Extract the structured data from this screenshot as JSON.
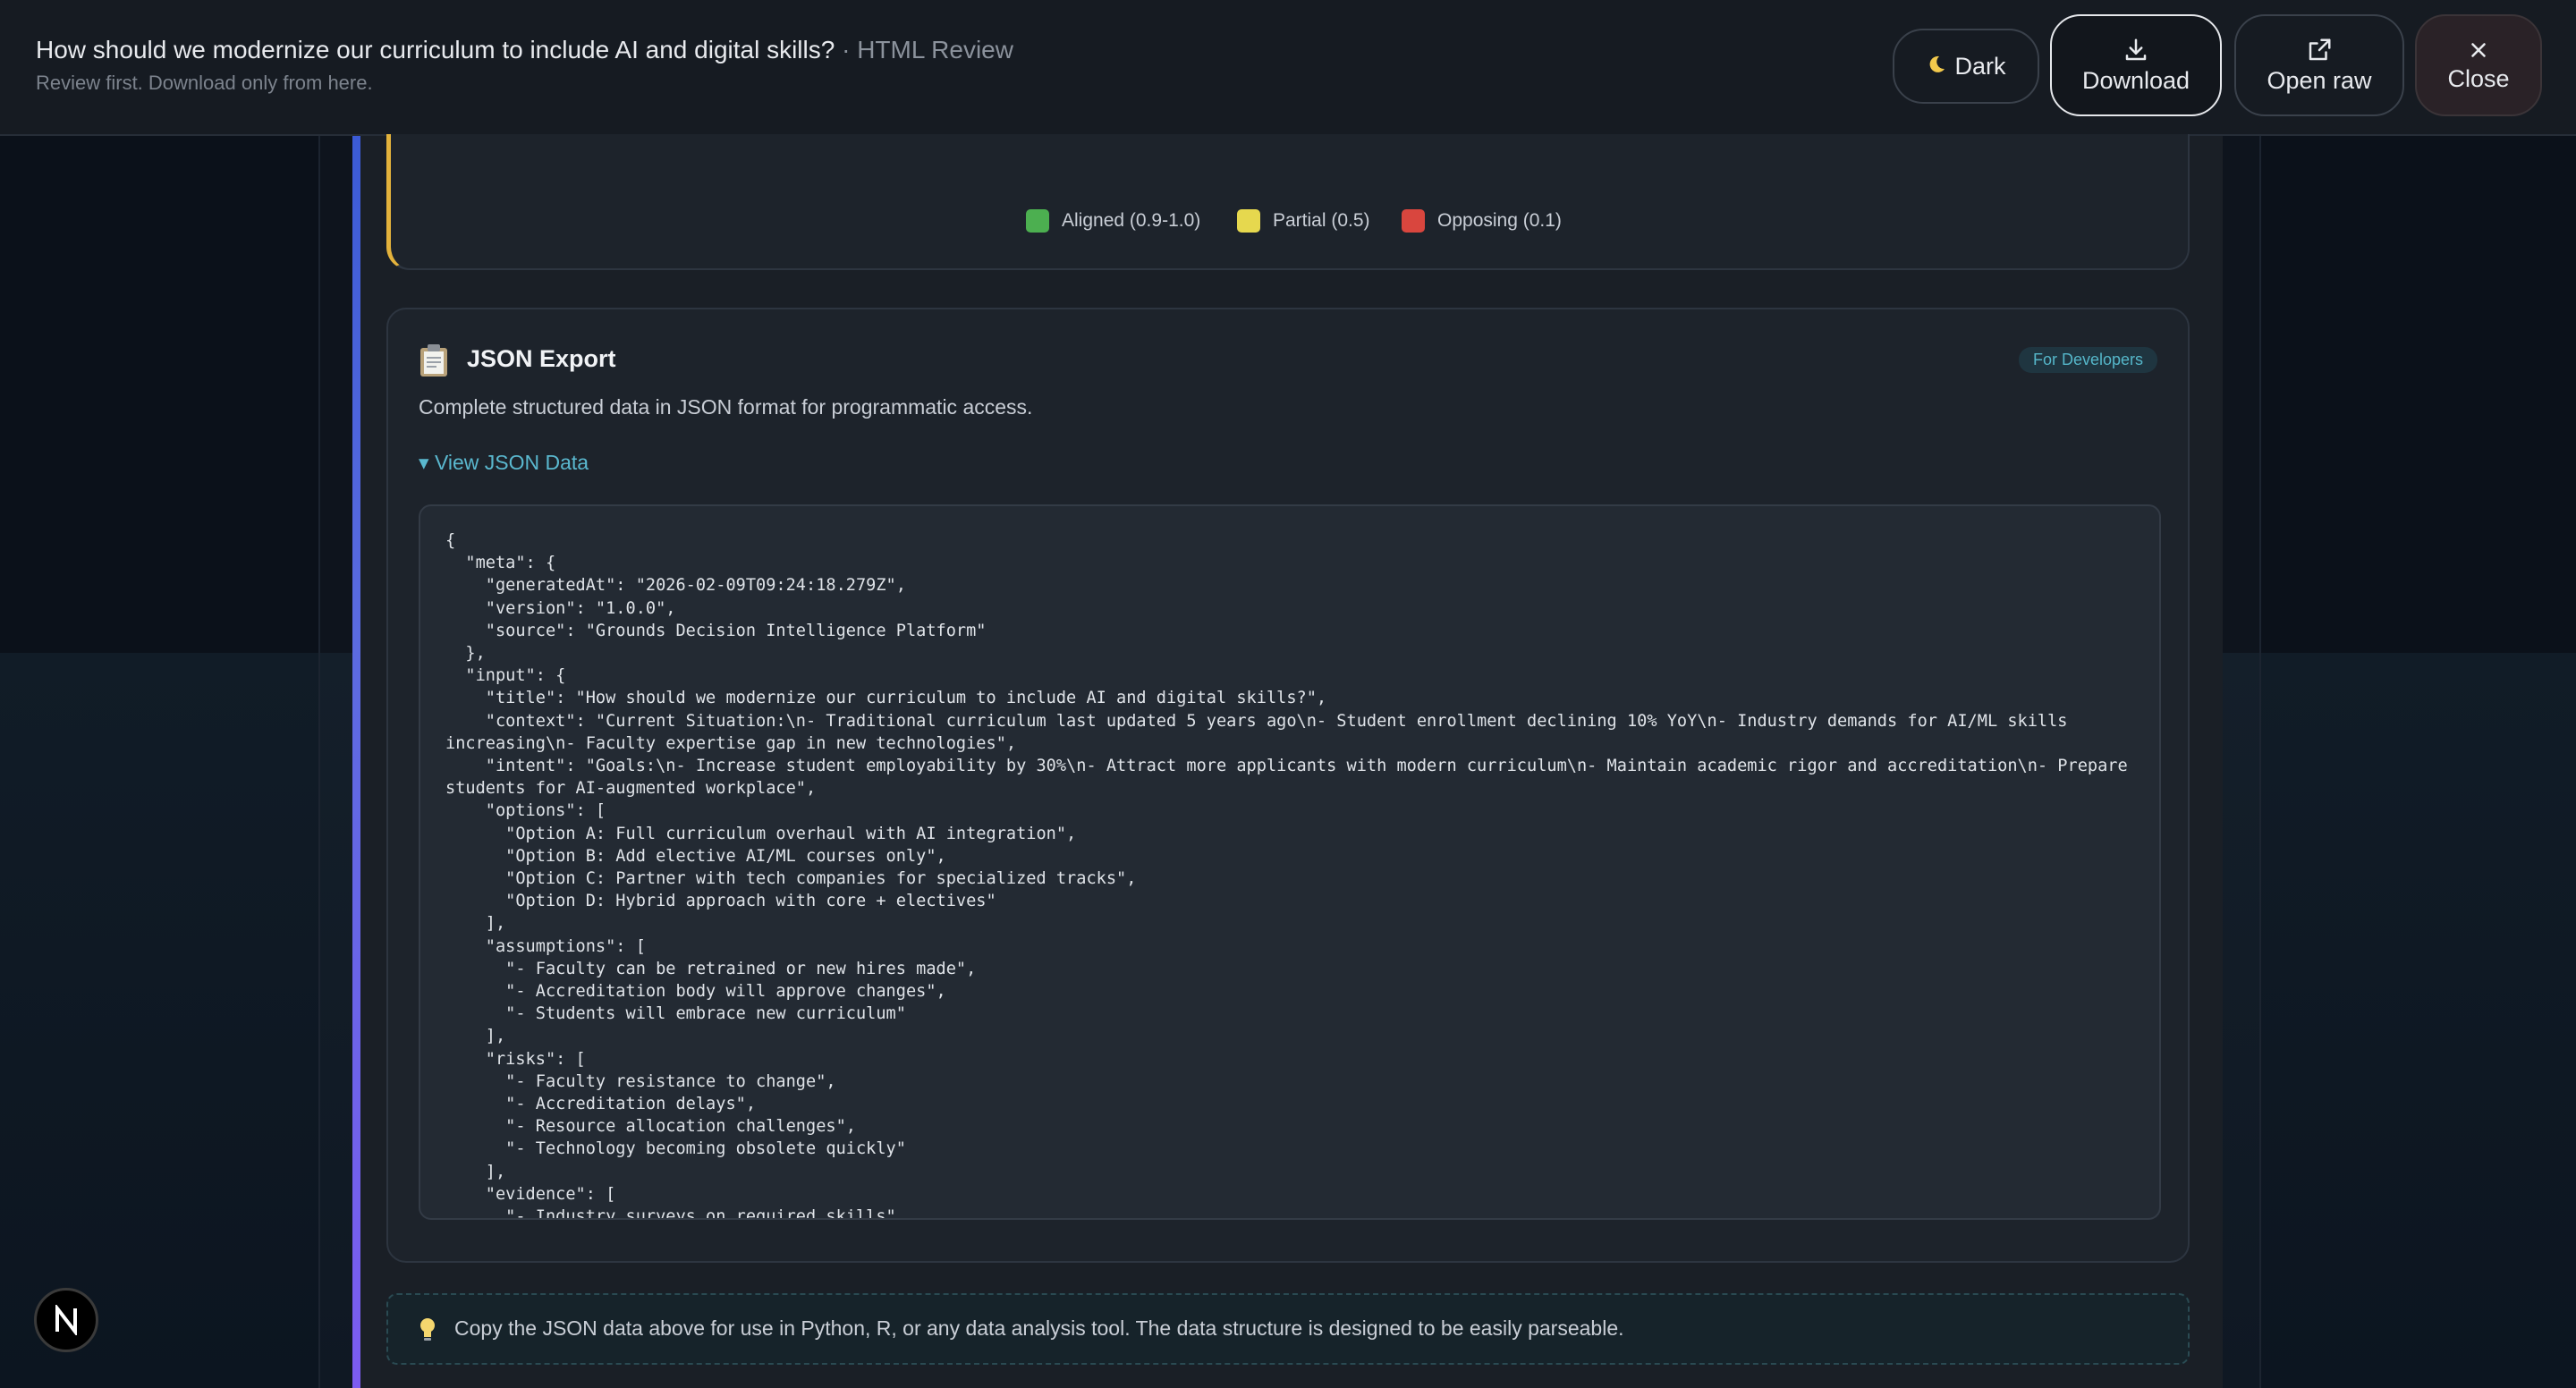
{
  "header": {
    "title": "How should we modernize our curriculum to include AI and digital skills?",
    "title_suffix": " · HTML Review",
    "subtitle": "Review first. Download only from here.",
    "buttons": {
      "dark": "Dark",
      "download": "Download",
      "open_raw": "Open raw",
      "close": "Close"
    }
  },
  "legend": {
    "items": [
      {
        "label": "Aligned (0.9-1.0)",
        "color": "#4caf50"
      },
      {
        "label": "Partial (0.5)",
        "color": "#e6d84e"
      },
      {
        "label": "Opposing (0.1)",
        "color": "#d9463e"
      }
    ],
    "accent_color": "#e3b23c"
  },
  "json_export": {
    "title": "JSON Export",
    "badge": "For Developers",
    "description": "Complete structured data in JSON format for programmatic access.",
    "toggle_label": "View JSON Data",
    "code": "{\n  \"meta\": {\n    \"generatedAt\": \"2026-02-09T09:24:18.279Z\",\n    \"version\": \"1.0.0\",\n    \"source\": \"Grounds Decision Intelligence Platform\"\n  },\n  \"input\": {\n    \"title\": \"How should we modernize our curriculum to include AI and digital skills?\",\n    \"context\": \"Current Situation:\\n- Traditional curriculum last updated 5 years ago\\n- Student enrollment declining 10% YoY\\n- Industry demands for AI/ML skills increasing\\n- Faculty expertise gap in new technologies\",\n    \"intent\": \"Goals:\\n- Increase student employability by 30%\\n- Attract more applicants with modern curriculum\\n- Maintain academic rigor and accreditation\\n- Prepare students for AI-augmented workplace\",\n    \"options\": [\n      \"Option A: Full curriculum overhaul with AI integration\",\n      \"Option B: Add elective AI/ML courses only\",\n      \"Option C: Partner with tech companies for specialized tracks\",\n      \"Option D: Hybrid approach with core + electives\"\n    ],\n    \"assumptions\": [\n      \"- Faculty can be retrained or new hires made\",\n      \"- Accreditation body will approve changes\",\n      \"- Students will embrace new curriculum\"\n    ],\n    \"risks\": [\n      \"- Faculty resistance to change\",\n      \"- Accreditation delays\",\n      \"- Resource allocation challenges\",\n      \"- Technology becoming obsolete quickly\"\n    ],\n    \"evidence\": [\n      \"- Industry surveys on required skills\","
  },
  "tip": {
    "text": "Copy the JSON data above for use in Python, R, or any data analysis tool. The data structure is designed to be easily parseable."
  },
  "badge_letter": "N"
}
